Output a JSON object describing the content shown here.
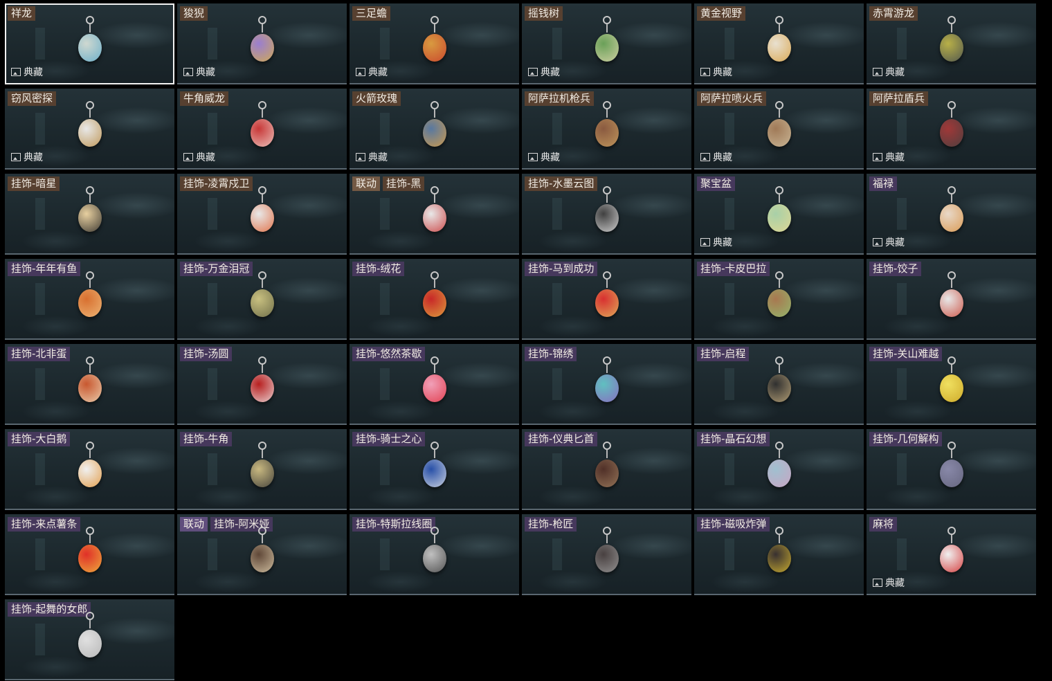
{
  "labels": {
    "collection": "典藏",
    "collab": "联动"
  },
  "items": [
    {
      "name": "祥龙",
      "style": "brown",
      "coll": true,
      "color": "#cfd8d0",
      "accent": "#5aa8c8"
    },
    {
      "name": "狻猊",
      "style": "brown",
      "coll": true,
      "color": "#9a7ed0",
      "accent": "#d8b040"
    },
    {
      "name": "三足蟾",
      "style": "brown",
      "coll": true,
      "color": "#d89a40",
      "accent": "#c83a2a"
    },
    {
      "name": "摇钱树",
      "style": "brown",
      "coll": true,
      "color": "#6aa058",
      "accent": "#e0d8b0"
    },
    {
      "name": "黄金视野",
      "style": "brown",
      "coll": true,
      "color": "#e8e0d0",
      "accent": "#d8a040"
    },
    {
      "name": "赤霄游龙",
      "style": "brown",
      "coll": true,
      "color": "#b8b048",
      "accent": "#404850"
    },
    {
      "name": "窃风密探",
      "style": "brown",
      "coll": true,
      "color": "#e8e8e8",
      "accent": "#b88a40"
    },
    {
      "name": "牛角威龙",
      "style": "brown",
      "coll": true,
      "color": "#c83838",
      "accent": "#f0d8d0"
    },
    {
      "name": "火箭玫瑰",
      "style": "brown",
      "coll": true,
      "color": "#5878a0",
      "accent": "#e0a040"
    },
    {
      "name": "阿萨拉机枪兵",
      "style": "brown",
      "coll": true,
      "color": "#8a5a40",
      "accent": "#c8a060"
    },
    {
      "name": "阿萨拉喷火兵",
      "style": "brown",
      "coll": true,
      "color": "#a07a58",
      "accent": "#d0c0a0"
    },
    {
      "name": "阿萨拉盾兵",
      "style": "brown",
      "coll": true,
      "color": "#a03838",
      "accent": "#404040"
    },
    {
      "name": "挂饰-暗星",
      "style": "brown",
      "coll": false,
      "color": "#e8d0a0",
      "accent": "#202020"
    },
    {
      "name": "挂饰-凌霄戍卫",
      "style": "brown",
      "coll": false,
      "color": "#e8e8e8",
      "accent": "#e06030"
    },
    {
      "name": "挂饰-黑",
      "style": "brown",
      "coll": false,
      "tag": "联动",
      "color": "#e8e8e8",
      "accent": "#c83030"
    },
    {
      "name": "挂饰-水墨云图",
      "style": "brown",
      "coll": false,
      "color": "#404040",
      "accent": "#e8e8e8"
    },
    {
      "name": "聚宝盆",
      "style": "purple",
      "coll": true,
      "color": "#a8d0a8",
      "accent": "#e8d890"
    },
    {
      "name": "福禄",
      "style": "purple",
      "coll": true,
      "color": "#e8d8c8",
      "accent": "#d89040"
    },
    {
      "name": "挂饰-年年有鱼",
      "style": "purple",
      "coll": false,
      "color": "#d87030",
      "accent": "#f0c080"
    },
    {
      "name": "挂饰-万金泪冠",
      "style": "purple",
      "coll": false,
      "color": "#c8c080",
      "accent": "#606040"
    },
    {
      "name": "挂饰-绒花",
      "style": "purple",
      "coll": false,
      "color": "#c82828",
      "accent": "#e0b040"
    },
    {
      "name": "挂饰-马到成功",
      "style": "purple",
      "coll": false,
      "color": "#d83030",
      "accent": "#e0c060"
    },
    {
      "name": "挂饰-卡皮巴拉",
      "style": "purple",
      "coll": false,
      "color": "#a87850",
      "accent": "#90c070"
    },
    {
      "name": "挂饰-饺子",
      "style": "purple",
      "coll": false,
      "color": "#e8e8e8",
      "accent": "#c84030"
    },
    {
      "name": "挂饰-北非蛋",
      "style": "purple",
      "coll": false,
      "color": "#c85830",
      "accent": "#f0e0c0"
    },
    {
      "name": "挂饰-汤圆",
      "style": "purple",
      "coll": false,
      "color": "#b82020",
      "accent": "#f0f0f0"
    },
    {
      "name": "挂饰-悠然茶歇",
      "style": "purple",
      "coll": false,
      "color": "#f0a0b8",
      "accent": "#e03040"
    },
    {
      "name": "挂饰-锦绣",
      "style": "purple",
      "coll": false,
      "color": "#60c0c0",
      "accent": "#9060c0"
    },
    {
      "name": "挂饰-启程",
      "style": "purple",
      "coll": false,
      "color": "#303030",
      "accent": "#c8b080"
    },
    {
      "name": "挂饰-关山难越",
      "style": "purple",
      "coll": false,
      "color": "#f0e060",
      "accent": "#c8a020"
    },
    {
      "name": "挂饰-大白鹅",
      "style": "purple",
      "coll": false,
      "color": "#f0f0f0",
      "accent": "#e09030"
    },
    {
      "name": "挂饰-牛角",
      "style": "purple",
      "coll": false,
      "color": "#c8b880",
      "accent": "#303030"
    },
    {
      "name": "挂饰-骑士之心",
      "style": "purple",
      "coll": false,
      "color": "#2850a8",
      "accent": "#e8e8e8"
    },
    {
      "name": "挂饰-仪典匕首",
      "style": "purple",
      "coll": false,
      "color": "#503028",
      "accent": "#a08060"
    },
    {
      "name": "挂饰-晶石幻想",
      "style": "purple",
      "coll": false,
      "color": "#a0c0d0",
      "accent": "#d0a0c0"
    },
    {
      "name": "挂饰-几何解构",
      "style": "purple",
      "coll": false,
      "color": "#8888a8",
      "accent": "#606078"
    },
    {
      "name": "挂饰-来点薯条",
      "style": "purple",
      "coll": false,
      "color": "#e03028",
      "accent": "#f0c040"
    },
    {
      "name": "挂饰-阿米娅",
      "style": "purple",
      "coll": false,
      "tag": "联动",
      "color": "#604838",
      "accent": "#e0d0b0"
    },
    {
      "name": "挂饰-特斯拉线圈",
      "style": "purple",
      "coll": false,
      "color": "#c0c0c0",
      "accent": "#404040"
    },
    {
      "name": "挂饰-枪匠",
      "style": "purple",
      "coll": false,
      "color": "#484040",
      "accent": "#a0a0a0"
    },
    {
      "name": "挂饰-磁吸炸弹",
      "style": "purple",
      "coll": false,
      "color": "#383030",
      "accent": "#e0c030"
    },
    {
      "name": "麻将",
      "style": "purple",
      "coll": true,
      "color": "#f0f0f0",
      "accent": "#d02020"
    },
    {
      "name": "挂饰-起舞的女郎",
      "style": "purple",
      "coll": false,
      "color": "#e0e0e0",
      "accent": "#b0b0b0"
    }
  ]
}
